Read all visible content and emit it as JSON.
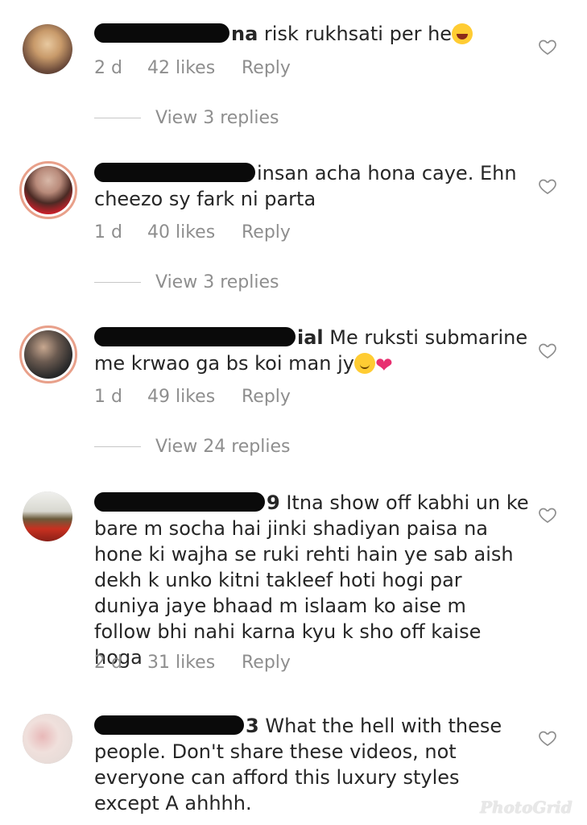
{
  "comments": [
    {
      "username_visible": "na",
      "text": " risk rukhsati per he",
      "time": "2 d",
      "likes": "42 likes",
      "reply": "Reply",
      "view_replies": "View 3 replies",
      "emoji": "grinning-sweat-emoji"
    },
    {
      "username_visible": "",
      "text": "insan acha hona caye.  Ehn cheezo sy fark ni parta",
      "time": "1 d",
      "likes": "40 likes",
      "reply": "Reply",
      "view_replies": "View 3 replies"
    },
    {
      "username_visible": "ial",
      "text": " Me ruksti submarine me krwao ga bs koi man jy",
      "time": "1 d",
      "likes": "49 likes",
      "reply": "Reply",
      "view_replies": "View 24 replies",
      "emoji": [
        "smiling-face-emoji",
        "broken-heart-emoji"
      ]
    },
    {
      "username_visible": "9",
      "text": " Itna show off kabhi un ke bare m socha hai jinki shadiyan paisa na hone ki wajha se ruki rehti hain ye sab aish dekh k unko kitni takleef hoti hogi par duniya jaye bhaad m islaam ko aise m follow bhi nahi karna kyu k sho off kaise hoga",
      "time": "2 d",
      "likes": "31 likes",
      "reply": "Reply"
    },
    {
      "username_visible": "3",
      "text": " What the hell with these people. Don't share these videos, not everyone can afford this luxury styles except A ahhhh."
    }
  ],
  "watermark": "PhotoGrid",
  "colors": {
    "text": "#262626",
    "meta": "#8e8e8e",
    "ring": "#e8a08a"
  },
  "icons": {
    "like": "heart-outline-icon"
  }
}
